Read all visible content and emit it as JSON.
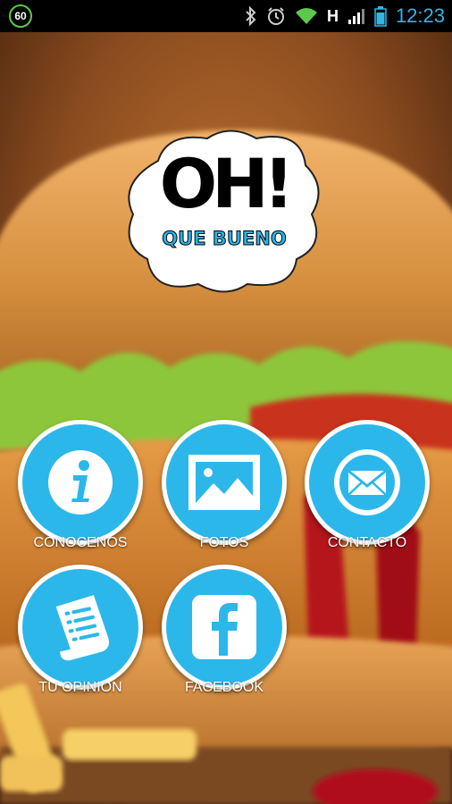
{
  "status_bar": {
    "badge": "60",
    "network_type": "H",
    "time": "12:23",
    "icons": [
      "bluetooth-icon",
      "alarm-icon",
      "wifi-icon",
      "signal-icon",
      "battery-icon"
    ]
  },
  "logo": {
    "title": "OH!",
    "subtitle": "QUE BUENO"
  },
  "menu": {
    "items": [
      {
        "label": "CONOCENOS",
        "icon": "info-icon"
      },
      {
        "label": "FOTOS",
        "icon": "image-icon"
      },
      {
        "label": "CONTACTO",
        "icon": "mail-icon"
      },
      {
        "label": "TU OPINION",
        "icon": "document-icon"
      },
      {
        "label": "FACEBOOK",
        "icon": "facebook-icon"
      }
    ]
  },
  "colors": {
    "accent": "#2cb7ea",
    "clock": "#33b5e5",
    "badge_ring": "#5dc94c"
  }
}
